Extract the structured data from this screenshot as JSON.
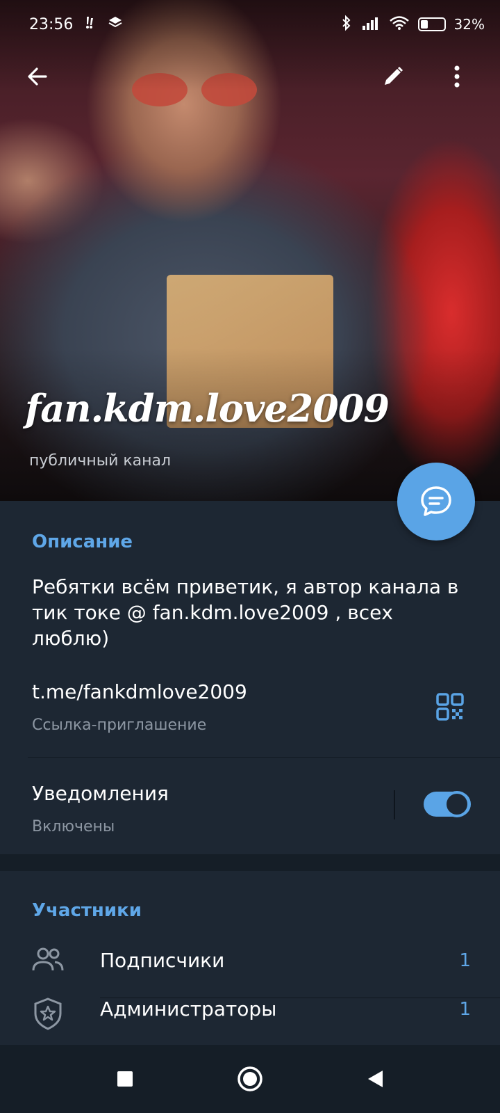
{
  "status_bar": {
    "time": "23:56",
    "battery_text": "32",
    "battery_level": 0.32
  },
  "header": {
    "channel_name": "fan.kdm.love2009",
    "channel_type": "публичный канал"
  },
  "info": {
    "description_title": "Описание",
    "description_text": "Ребятки всём приветик, я автор канала в тик токе @ fan.kdm.love2009 , всех люблю)",
    "link": "t.me/fankdmlove2009",
    "link_label": "Ссылка-приглашение",
    "notifications_title": "Уведомления",
    "notifications_state": "Включены",
    "notifications_enabled": true
  },
  "members": {
    "title": "Участники",
    "rows": [
      {
        "label": "Подписчики",
        "count": "1",
        "icon": "people-icon"
      },
      {
        "label": "Администраторы",
        "count": "1",
        "icon": "admin-shield-icon"
      }
    ]
  },
  "colors": {
    "accent": "#5aa4e6",
    "background": "#1d2733",
    "secondary_text": "#8d97a3"
  }
}
